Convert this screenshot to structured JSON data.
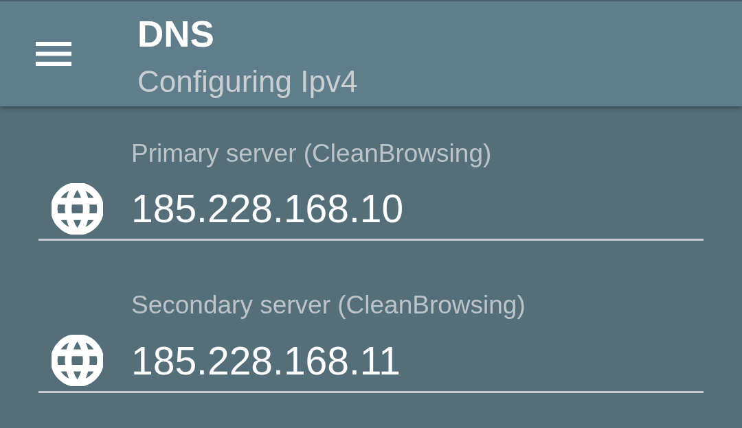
{
  "app_bar": {
    "title": "DNS",
    "subtitle": "Configuring Ipv4"
  },
  "fields": [
    {
      "label": "Primary server (CleanBrowsing)",
      "value": "185.228.168.10"
    },
    {
      "label": "Secondary server (CleanBrowsing)",
      "value": "185.228.168.11"
    }
  ]
}
